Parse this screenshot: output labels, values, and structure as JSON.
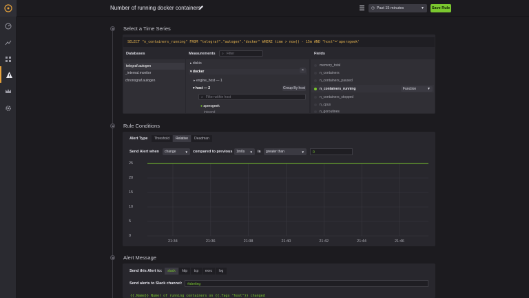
{
  "sidebar": {
    "items": [
      {
        "name": "dashboard",
        "icon": "dashboard-icon"
      },
      {
        "name": "graphs",
        "icon": "graph-icon"
      },
      {
        "name": "hosts",
        "icon": "hosts-icon"
      },
      {
        "name": "alerts",
        "icon": "alert-icon",
        "active": true
      },
      {
        "name": "admin",
        "icon": "crown-icon"
      },
      {
        "name": "settings",
        "icon": "gear-icon"
      }
    ]
  },
  "header": {
    "title": "Number of running docker containers",
    "time_range": "Past 15 minutes",
    "save_label": "Save Rule"
  },
  "colors": {
    "accent": "#7ac72f",
    "query": "#e6b450",
    "warning": "#e6a23c"
  },
  "series_section": {
    "title": "Select a Time Series",
    "query": "SELECT \"n_containers_running\" FROM \"telegraf\".\"autogen\".\"docker\" WHERE time > now() - 15m AND \"host\"='apersgeek'",
    "databases_label": "Databases",
    "databases": [
      "telegraf.autogen",
      "_internal.monitor",
      "chronograf.autogen"
    ],
    "measurements_label": "Measurements",
    "filter_placeholder": "Filter",
    "measurements": [
      {
        "label": "diskio"
      },
      {
        "label": "docker"
      },
      {
        "label": "engine_host — 1"
      },
      {
        "label": "host — 2"
      }
    ],
    "group_by_label": "Group By host",
    "filter_host_placeholder": "Filter within host",
    "hosts": [
      "apersgeek",
      "inteand"
    ],
    "fields_label": "Fields",
    "fields": [
      "memory_total",
      "n_containers",
      "n_containers_paused",
      "n_containers_running",
      "n_containers_stopped",
      "n_cpus",
      "n_goroutines"
    ],
    "function_label": "Function"
  },
  "rule_section": {
    "title": "Rule Conditions",
    "alert_type_label": "Alert Type",
    "tabs": [
      "Threshold",
      "Relative",
      "Deadman"
    ],
    "send_label": "Send Alert when",
    "change_value": "change",
    "compared_label": "compared to previous",
    "period_value": "1m0s",
    "is_label": "is",
    "operator_value": "greater than",
    "threshold_value": "0"
  },
  "chart_data": {
    "type": "line",
    "x": [
      "21:34",
      "21:36",
      "21:38",
      "21:40",
      "21:42",
      "21:44",
      "21:46"
    ],
    "series": [
      {
        "values": [
          25,
          25,
          25,
          25,
          25,
          25,
          25
        ]
      }
    ],
    "yticks": [
      "25",
      "20",
      "15",
      "10",
      "5",
      "0"
    ],
    "ylim": [
      0,
      25
    ],
    "grid": true
  },
  "message_section": {
    "title": "Alert Message",
    "send_to_label": "Send this Alert to:",
    "services": [
      "slack",
      "http",
      "tcp",
      "exec",
      "log"
    ],
    "channel_label": "Send alerts to Slack channel:",
    "channel_value": "#alerting",
    "message": "{{.Name}} Numer of running containers on {{.Tags \"host\"}} changed"
  }
}
